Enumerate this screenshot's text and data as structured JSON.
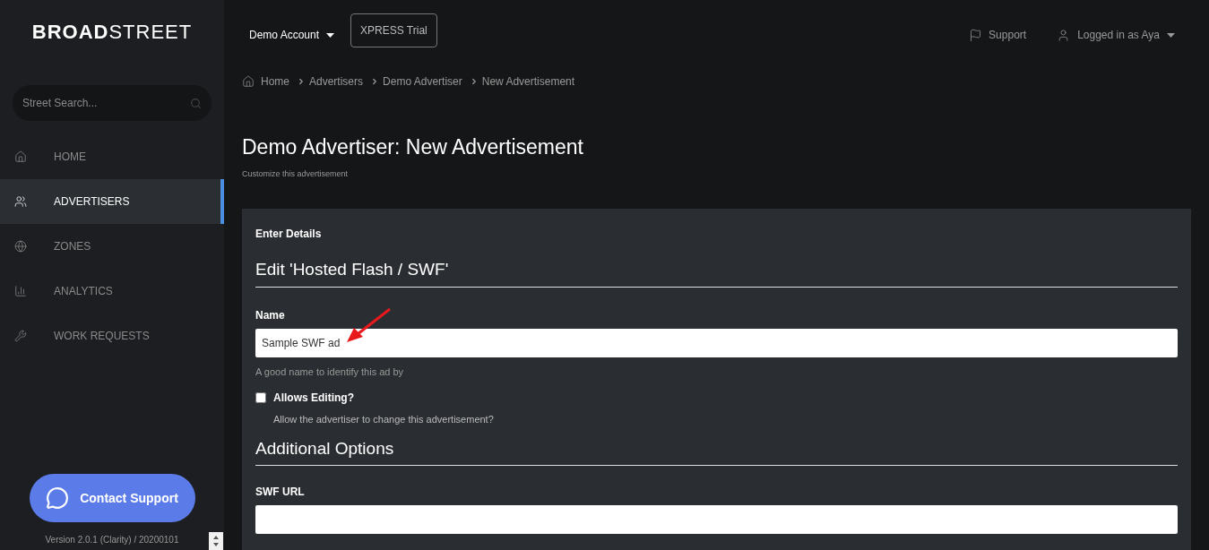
{
  "logo": "**BROAD**STREET",
  "topbar": {
    "account": "Demo Account",
    "trial_button": "XPRESS Trial",
    "support": "Support",
    "user": "Logged in as Aya"
  },
  "sidebar": {
    "search": {
      "placeholder": "Street Search..."
    },
    "items": [
      {
        "label": "HOME",
        "selected": false
      },
      {
        "label": "ADVERTISERS",
        "selected": true
      },
      {
        "label": "ZONES",
        "selected": false
      },
      {
        "label": "ANALYTICS",
        "selected": false
      },
      {
        "label": "WORK REQUESTS",
        "selected": false
      }
    ],
    "contact_button": "Contact Support",
    "version": "Version 2.0.1 (Clarity) / 20200101"
  },
  "breadcrumb": [
    "Home",
    "Advertisers",
    "Demo Advertiser",
    "New Advertisement"
  ],
  "page": {
    "title": "Demo Advertiser: New Advertisement",
    "subtitle": "Customize this advertisement"
  },
  "panel": {
    "heading": "Enter Details",
    "section_title": "Edit 'Hosted Flash / SWF'",
    "name_field": {
      "label": "Name",
      "value": "Sample SWF ad",
      "help": "A good name to identify this ad by"
    },
    "allows_editing": {
      "label": "Allows Editing?",
      "checked": false,
      "help": "Allow the advertiser to change this advertisement?"
    },
    "options_title": "Additional Options",
    "swf_url_field": {
      "label": "SWF URL"
    }
  }
}
